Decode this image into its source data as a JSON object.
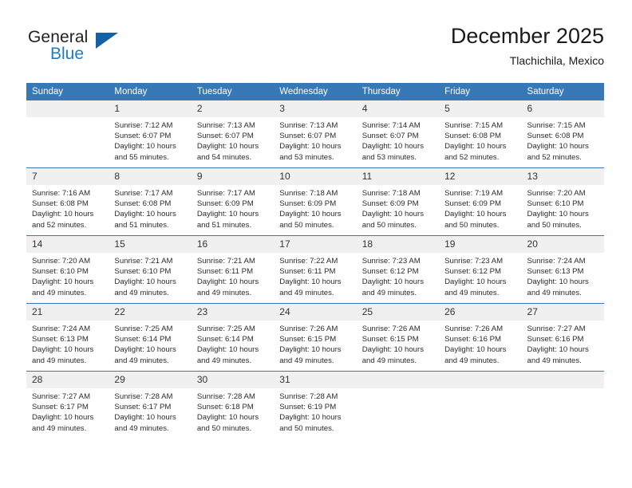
{
  "brand": {
    "name_part1": "General",
    "name_part2": "Blue",
    "triangle_color": "#1462a5",
    "blue_color": "#1f7dc4"
  },
  "header": {
    "title": "December 2025",
    "subtitle": "Tlachichila, Mexico"
  },
  "theme": {
    "header_bar_color": "#3778b7",
    "daynum_strip_color": "#f0f0f0",
    "text_color": "#2b2b2b"
  },
  "weekday_headers": [
    "Sunday",
    "Monday",
    "Tuesday",
    "Wednesday",
    "Thursday",
    "Friday",
    "Saturday"
  ],
  "weeks": [
    [
      {
        "day": "",
        "lines": []
      },
      {
        "day": "1",
        "lines": [
          "Sunrise: 7:12 AM",
          "Sunset: 6:07 PM",
          "Daylight: 10 hours",
          "and 55 minutes."
        ]
      },
      {
        "day": "2",
        "lines": [
          "Sunrise: 7:13 AM",
          "Sunset: 6:07 PM",
          "Daylight: 10 hours",
          "and 54 minutes."
        ]
      },
      {
        "day": "3",
        "lines": [
          "Sunrise: 7:13 AM",
          "Sunset: 6:07 PM",
          "Daylight: 10 hours",
          "and 53 minutes."
        ]
      },
      {
        "day": "4",
        "lines": [
          "Sunrise: 7:14 AM",
          "Sunset: 6:07 PM",
          "Daylight: 10 hours",
          "and 53 minutes."
        ]
      },
      {
        "day": "5",
        "lines": [
          "Sunrise: 7:15 AM",
          "Sunset: 6:08 PM",
          "Daylight: 10 hours",
          "and 52 minutes."
        ]
      },
      {
        "day": "6",
        "lines": [
          "Sunrise: 7:15 AM",
          "Sunset: 6:08 PM",
          "Daylight: 10 hours",
          "and 52 minutes."
        ]
      }
    ],
    [
      {
        "day": "7",
        "lines": [
          "Sunrise: 7:16 AM",
          "Sunset: 6:08 PM",
          "Daylight: 10 hours",
          "and 52 minutes."
        ]
      },
      {
        "day": "8",
        "lines": [
          "Sunrise: 7:17 AM",
          "Sunset: 6:08 PM",
          "Daylight: 10 hours",
          "and 51 minutes."
        ]
      },
      {
        "day": "9",
        "lines": [
          "Sunrise: 7:17 AM",
          "Sunset: 6:09 PM",
          "Daylight: 10 hours",
          "and 51 minutes."
        ]
      },
      {
        "day": "10",
        "lines": [
          "Sunrise: 7:18 AM",
          "Sunset: 6:09 PM",
          "Daylight: 10 hours",
          "and 50 minutes."
        ]
      },
      {
        "day": "11",
        "lines": [
          "Sunrise: 7:18 AM",
          "Sunset: 6:09 PM",
          "Daylight: 10 hours",
          "and 50 minutes."
        ]
      },
      {
        "day": "12",
        "lines": [
          "Sunrise: 7:19 AM",
          "Sunset: 6:09 PM",
          "Daylight: 10 hours",
          "and 50 minutes."
        ]
      },
      {
        "day": "13",
        "lines": [
          "Sunrise: 7:20 AM",
          "Sunset: 6:10 PM",
          "Daylight: 10 hours",
          "and 50 minutes."
        ]
      }
    ],
    [
      {
        "day": "14",
        "lines": [
          "Sunrise: 7:20 AM",
          "Sunset: 6:10 PM",
          "Daylight: 10 hours",
          "and 49 minutes."
        ]
      },
      {
        "day": "15",
        "lines": [
          "Sunrise: 7:21 AM",
          "Sunset: 6:10 PM",
          "Daylight: 10 hours",
          "and 49 minutes."
        ]
      },
      {
        "day": "16",
        "lines": [
          "Sunrise: 7:21 AM",
          "Sunset: 6:11 PM",
          "Daylight: 10 hours",
          "and 49 minutes."
        ]
      },
      {
        "day": "17",
        "lines": [
          "Sunrise: 7:22 AM",
          "Sunset: 6:11 PM",
          "Daylight: 10 hours",
          "and 49 minutes."
        ]
      },
      {
        "day": "18",
        "lines": [
          "Sunrise: 7:23 AM",
          "Sunset: 6:12 PM",
          "Daylight: 10 hours",
          "and 49 minutes."
        ]
      },
      {
        "day": "19",
        "lines": [
          "Sunrise: 7:23 AM",
          "Sunset: 6:12 PM",
          "Daylight: 10 hours",
          "and 49 minutes."
        ]
      },
      {
        "day": "20",
        "lines": [
          "Sunrise: 7:24 AM",
          "Sunset: 6:13 PM",
          "Daylight: 10 hours",
          "and 49 minutes."
        ]
      }
    ],
    [
      {
        "day": "21",
        "lines": [
          "Sunrise: 7:24 AM",
          "Sunset: 6:13 PM",
          "Daylight: 10 hours",
          "and 49 minutes."
        ]
      },
      {
        "day": "22",
        "lines": [
          "Sunrise: 7:25 AM",
          "Sunset: 6:14 PM",
          "Daylight: 10 hours",
          "and 49 minutes."
        ]
      },
      {
        "day": "23",
        "lines": [
          "Sunrise: 7:25 AM",
          "Sunset: 6:14 PM",
          "Daylight: 10 hours",
          "and 49 minutes."
        ]
      },
      {
        "day": "24",
        "lines": [
          "Sunrise: 7:26 AM",
          "Sunset: 6:15 PM",
          "Daylight: 10 hours",
          "and 49 minutes."
        ]
      },
      {
        "day": "25",
        "lines": [
          "Sunrise: 7:26 AM",
          "Sunset: 6:15 PM",
          "Daylight: 10 hours",
          "and 49 minutes."
        ]
      },
      {
        "day": "26",
        "lines": [
          "Sunrise: 7:26 AM",
          "Sunset: 6:16 PM",
          "Daylight: 10 hours",
          "and 49 minutes."
        ]
      },
      {
        "day": "27",
        "lines": [
          "Sunrise: 7:27 AM",
          "Sunset: 6:16 PM",
          "Daylight: 10 hours",
          "and 49 minutes."
        ]
      }
    ],
    [
      {
        "day": "28",
        "lines": [
          "Sunrise: 7:27 AM",
          "Sunset: 6:17 PM",
          "Daylight: 10 hours",
          "and 49 minutes."
        ]
      },
      {
        "day": "29",
        "lines": [
          "Sunrise: 7:28 AM",
          "Sunset: 6:17 PM",
          "Daylight: 10 hours",
          "and 49 minutes."
        ]
      },
      {
        "day": "30",
        "lines": [
          "Sunrise: 7:28 AM",
          "Sunset: 6:18 PM",
          "Daylight: 10 hours",
          "and 50 minutes."
        ]
      },
      {
        "day": "31",
        "lines": [
          "Sunrise: 7:28 AM",
          "Sunset: 6:19 PM",
          "Daylight: 10 hours",
          "and 50 minutes."
        ]
      },
      {
        "day": "",
        "lines": []
      },
      {
        "day": "",
        "lines": []
      },
      {
        "day": "",
        "lines": []
      }
    ]
  ]
}
